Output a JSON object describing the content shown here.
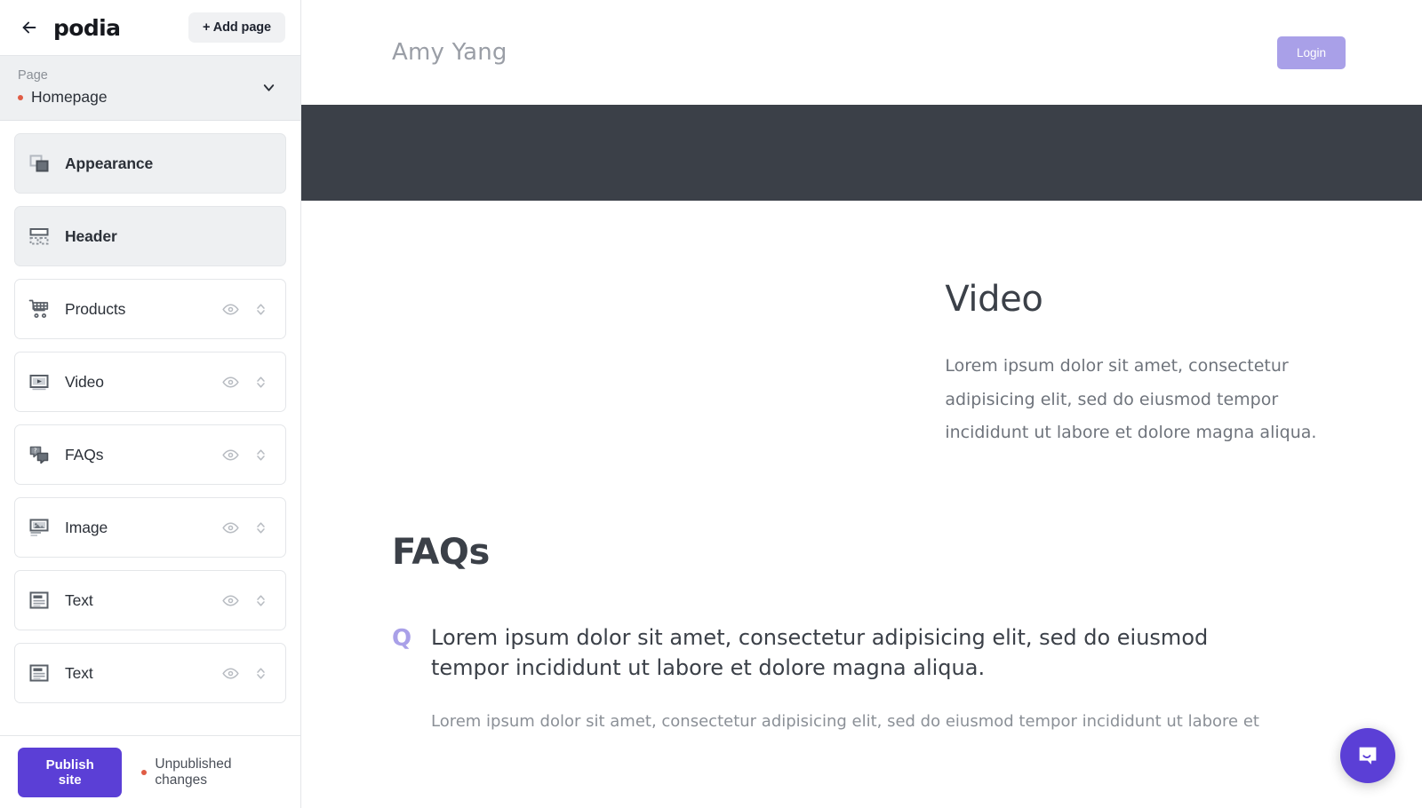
{
  "sidebar": {
    "back_icon": "back-arrow-icon",
    "brand": "podia",
    "add_page_label": "+ Add page",
    "page_picker": {
      "label": "Page",
      "current": "Homepage",
      "status_dot_color": "#e05c45",
      "chevron_icon": "chevron-down-icon"
    },
    "blocks": [
      {
        "label": "Appearance",
        "icon": "layers-icon",
        "shaded": true,
        "has_actions": false
      },
      {
        "label": "Header",
        "icon": "header-layout-icon",
        "shaded": true,
        "has_actions": false
      },
      {
        "label": "Products",
        "icon": "shopping-cart-icon",
        "shaded": false,
        "has_actions": true
      },
      {
        "label": "Video",
        "icon": "video-play-icon",
        "shaded": false,
        "has_actions": true
      },
      {
        "label": "FAQs",
        "icon": "chat-question-icon",
        "shaded": false,
        "has_actions": true
      },
      {
        "label": "Image",
        "icon": "image-icon",
        "shaded": false,
        "has_actions": true
      },
      {
        "label": "Text",
        "icon": "text-block-icon",
        "shaded": false,
        "has_actions": true
      },
      {
        "label": "Text",
        "icon": "text-block-icon",
        "shaded": false,
        "has_actions": true
      }
    ],
    "row_action_icons": {
      "visibility": "eye-icon",
      "reorder": "up-down-chevron-icon"
    },
    "footer": {
      "publish_label": "Publish site",
      "publish_color": "#5b3fd6",
      "status_text": "Unpublished changes",
      "status_dot_color": "#e05c45"
    }
  },
  "preview": {
    "site_header": {
      "brand": "Amy Yang",
      "login_label": "Login",
      "login_color": "#a9a0e8"
    },
    "dark_band_color": "#3b4048",
    "video_section": {
      "title": "Video",
      "body": "Lorem ipsum dolor sit amet, consectetur adipisicing elit, sed do eiusmod tempor incididunt ut labore et dolore magna aliqua."
    },
    "faq_section": {
      "title": "FAQs",
      "items": [
        {
          "marker": "Q",
          "marker_color": "#a9a0e8",
          "question": "Lorem ipsum dolor sit amet, consectetur adipisicing elit, sed do eiusmod tempor incididunt ut labore et dolore magna aliqua.",
          "answer": "Lorem ipsum dolor sit amet, consectetur adipisicing elit, sed do eiusmod tempor incididunt ut labore et"
        }
      ]
    },
    "chat_widget": {
      "icon": "chat-bubble-icon",
      "color": "#5b3fd6"
    }
  }
}
